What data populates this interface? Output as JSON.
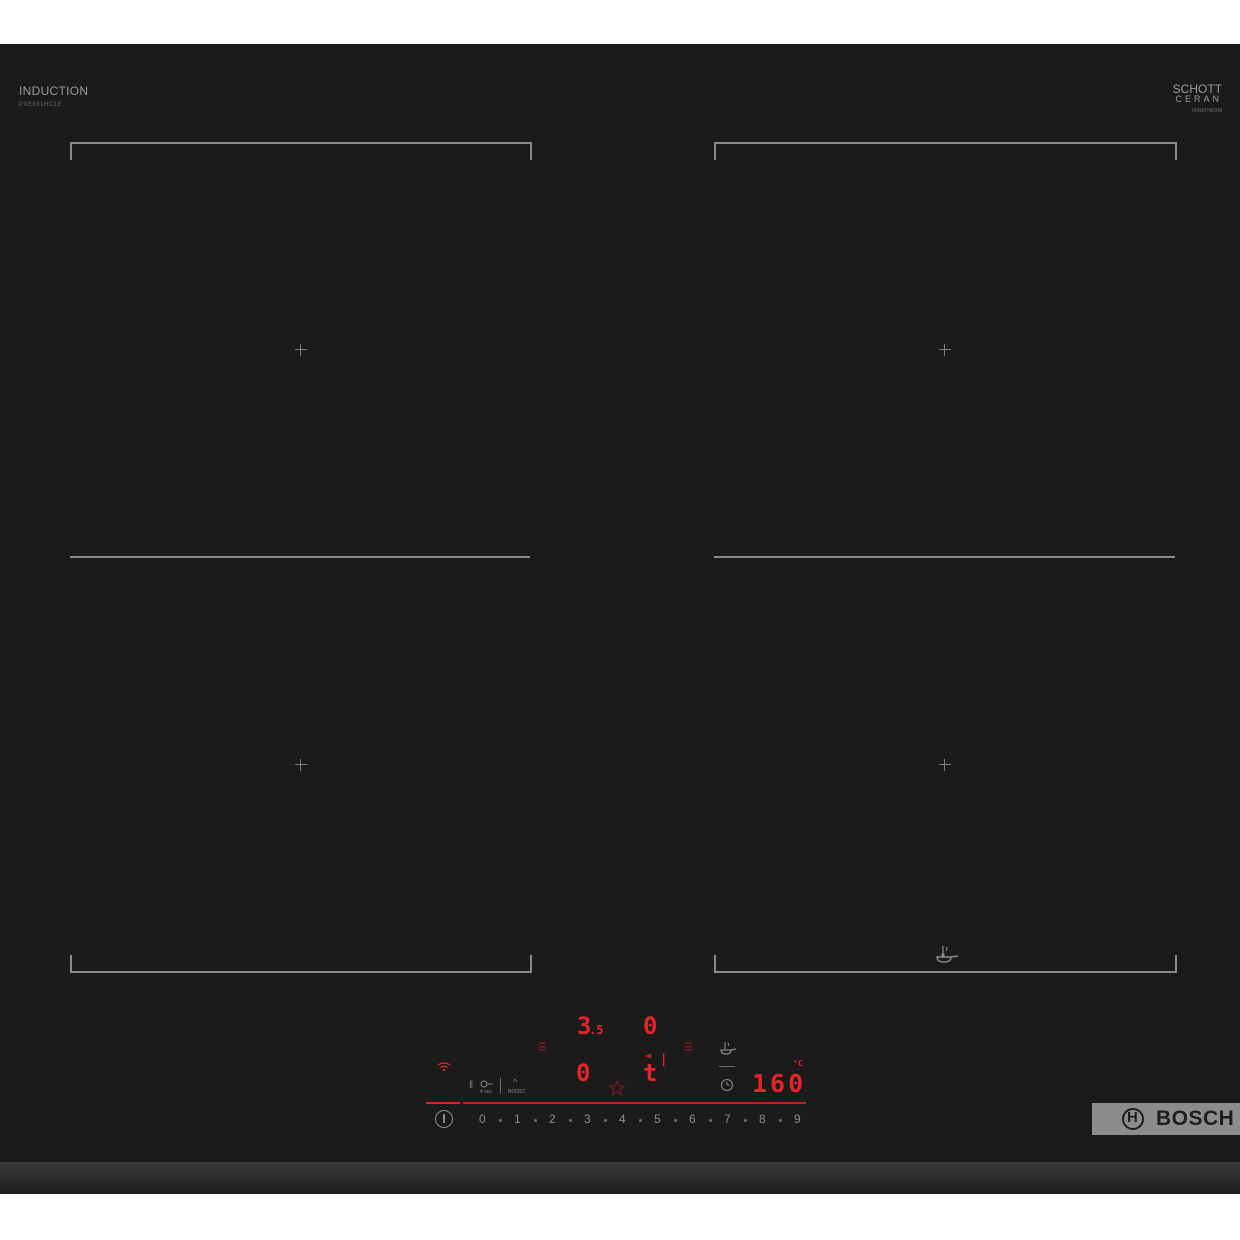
{
  "brand_left": {
    "title": "INDUCTION",
    "model": "PXE631HC1E"
  },
  "brand_right": {
    "line1": "SCHOTT",
    "line2": "CERAN",
    "line3": "MIRATHERM"
  },
  "display": {
    "zone_top_left_level": "3",
    "zone_top_left_decimal": ".5",
    "zone_top_right_level": "0",
    "zone_bottom_left_level": "0",
    "zone_bottom_right_level": "t",
    "frying_temp": "160",
    "temp_unit": "°C"
  },
  "controls": {
    "boost_label": "BOOST",
    "lock_label": "4 sec",
    "scale": [
      "0",
      "1",
      "2",
      "3",
      "4",
      "5",
      "6",
      "7",
      "8",
      "9"
    ]
  },
  "logo": {
    "text": "BOSCH"
  },
  "colors": {
    "glass": "#1b1b1b",
    "display_red": "#e4242b",
    "outline": "#8a8a8a"
  }
}
